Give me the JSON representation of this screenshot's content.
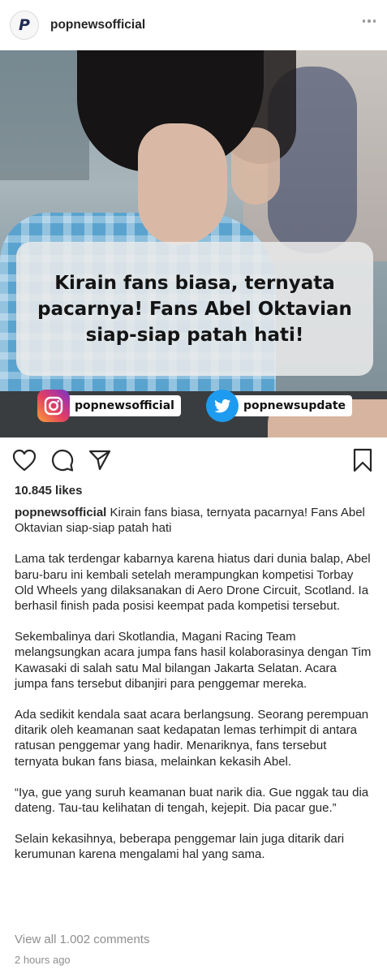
{
  "post": {
    "username": "popnewsofficial",
    "avatar_letter": "P",
    "more_icon": "more-horizontal-icon"
  },
  "image": {
    "headline": "Kirain fans biasa, ternyata pacarnya! Fans Abel Oktavian siap-siap patah hati!",
    "instagram_handle": "popnewsofficial",
    "twitter_handle": "popnewsupdate",
    "colors": {
      "instagram": "#e4405f",
      "twitter": "#1d9bf0"
    }
  },
  "actions": {
    "icons": [
      "heart-icon",
      "comment-icon",
      "share-icon",
      "bookmark-icon"
    ]
  },
  "likes": "10.845 likes",
  "caption": {
    "username": "popnewsofficial",
    "first_line": "Kirain fans biasa, ternyata pacarnya! Fans Abel Oktavian siap-siap patah hati",
    "paragraphs": [
      "Lama tak terdengar kabarnya karena hiatus dari dunia balap, Abel baru-baru ini kembali setelah merampungkan kompetisi Torbay Old Wheels yang dilaksanakan di Aero Drone Circuit, Scotland. Ia berhasil finish pada posisi keempat pada kompetisi tersebut.",
      "Sekembalinya dari Skotlandia, Magani Racing Team melangsungkan acara jumpa fans hasil kolaborasinya dengan Tim Kawasaki di salah satu Mal bilangan Jakarta Selatan. Acara jumpa fans tersebut dibanjiri para penggemar mereka.",
      "Ada sedikit kendala saat acara berlangsung. Seorang perempuan ditarik oleh keamanan saat kedapatan lemas terhimpit di antara ratusan penggemar yang hadir. Menariknya, fans tersebut ternyata bukan fans biasa, melainkan kekasih Abel.",
      "“Iya, gue yang suruh keamanan buat narik dia. Gue nggak tau dia dateng. Tau-tau kelihatan di tengah, kejepit. Dia pacar gue.”",
      "Selain kekasihnya, beberapa penggemar lain juga ditarik dari kerumunan karena mengalami hal yang sama."
    ]
  },
  "view_all_comments": "View all 1.002 comments",
  "timestamp": "2 hours ago"
}
